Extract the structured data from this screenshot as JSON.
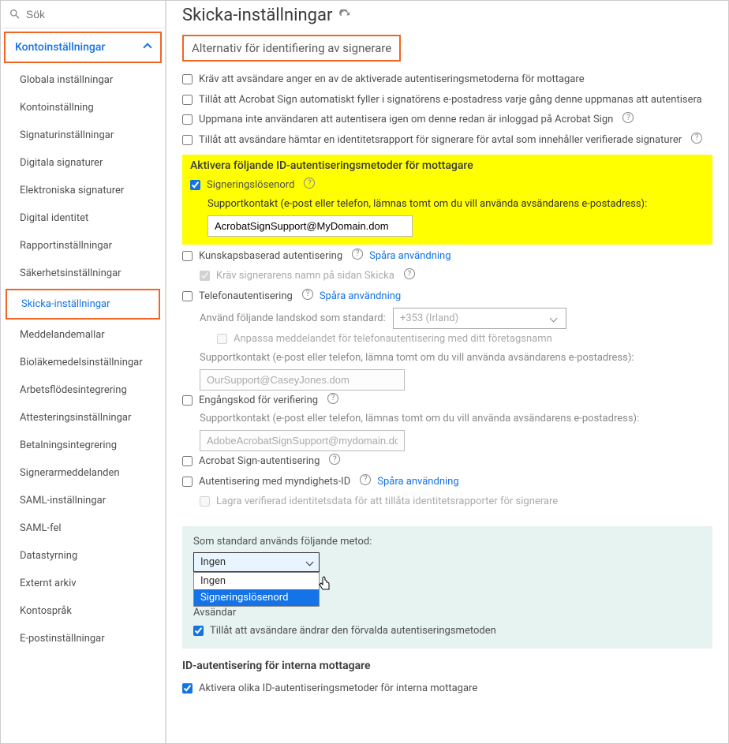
{
  "search": {
    "placeholder": "Sök"
  },
  "sidebar": {
    "header": "Kontoinställningar",
    "items": [
      "Globala inställningar",
      "Kontoinställning",
      "Signaturinställningar",
      "Digitala signaturer",
      "Elektroniska signaturer",
      "Digital identitet",
      "Rapportinställningar",
      "Säkerhetsinställningar",
      "Skicka-inställningar",
      "Meddelandemallar",
      "Bioläkemedelsinställningar",
      "Arbetsflödesintegrering",
      "Attesteringsinställningar",
      "Betalningsintegrering",
      "Signerarmeddelanden",
      "SAML-inställningar",
      "SAML-fel",
      "Datastyrning",
      "Externt arkiv",
      "Kontospråk",
      "E-postinställningar"
    ],
    "active_index": 8
  },
  "main": {
    "title": "Skicka-inställningar",
    "section_title": "Alternativ för identifiering av signerare",
    "opts": [
      "Kräv att avsändare anger en av de aktiverade autentiseringsmetoderna för mottagare",
      "Tillåt att Acrobat Sign automatiskt fyller i signatörens e-postadress varje gång denne uppmanas att autentisera",
      "Uppmana inte användaren att autentisera igen om denne redan är inloggad på Acrobat Sign",
      "Tillåt att avsändare hämtar en identitetsrapport för signerare för avtal som innehåller verifierade signaturer"
    ],
    "enable_heading": "Aktivera följande ID-autentiseringsmetoder för mottagare",
    "pwd": {
      "label": "Signeringslösenord",
      "support_label": "Supportkontakt (e-post eller telefon, lämnas tomt om du vill använda avsändarens e-postadress):",
      "value": "AcrobatSignSupport@MyDomain.dom"
    },
    "kba": {
      "label": "Kunskapsbaserad autentisering",
      "track": "Spåra användning",
      "sub": "Kräv signerarens namn på sidan Skicka"
    },
    "phone": {
      "label": "Telefonautentisering",
      "track": "Spåra användning",
      "country_label": "Använd följande landskod som standard:",
      "country_value": "+353 (Irland)",
      "customize": "Anpassa meddelandet för telefonautentisering med ditt företagsnamn",
      "support_label": "Supportkontakt (e-post eller telefon, lämna tomt om du vill använda avsändarens e-postadress):",
      "support_value": "OurSupport@CaseyJones.dom"
    },
    "otp": {
      "label": "Engångskod för verifiering",
      "support_label": "Supportkontakt (e-post eller telefon, lämnas tomt om du vill använda avsändarens e-postadress):",
      "support_value": "AdobeAcrobatSignSupport@mydomain.dor"
    },
    "asauth": {
      "label": "Acrobat Sign-autentisering"
    },
    "gov": {
      "label": "Autentisering med myndighets-ID",
      "track": "Spåra användning",
      "sub": "Lagra verifierad identitetsdata för att tillåta identitetsrapporter för signerare"
    },
    "default_method": {
      "label": "Som standard används följande metod:",
      "selected": "Ingen",
      "options": [
        "Ingen",
        "Signeringslösenord"
      ]
    },
    "sender_settings": {
      "heading_partial": "Avsändar",
      "allow_change": "Tillåt att avsändare ändrar den förvalda autentiseringsmetoden"
    },
    "internal": {
      "heading": "ID-autentisering för interna mottagare",
      "enable": "Aktivera olika ID-autentiseringsmetoder för interna mottagare"
    }
  }
}
